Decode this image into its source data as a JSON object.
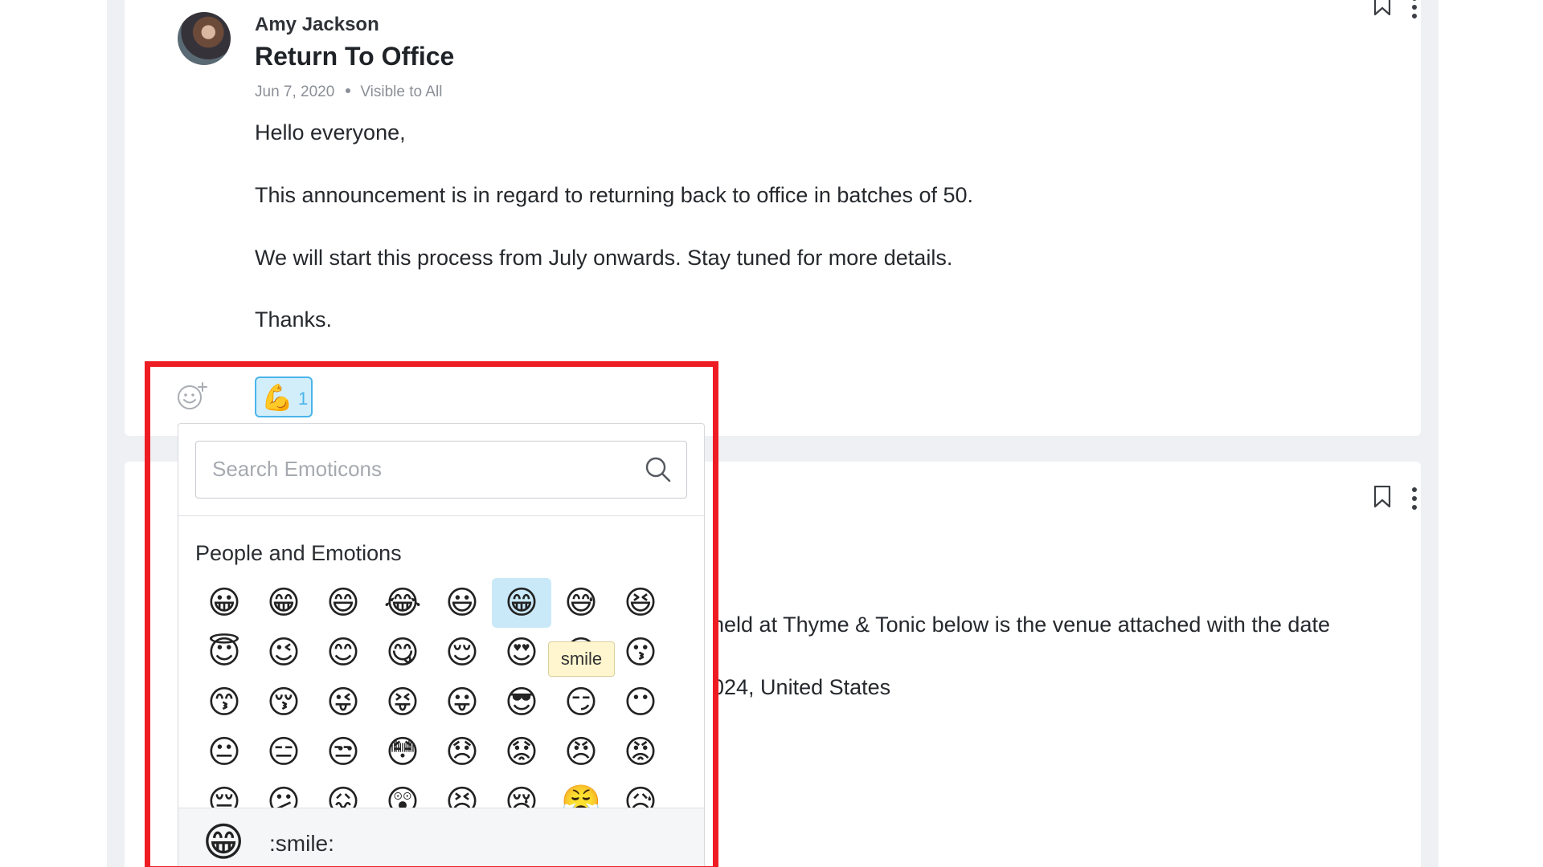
{
  "post1": {
    "author": "Amy Jackson",
    "title": "Return To Office",
    "date": "Jun 7, 2020",
    "visibility": "Visible to All",
    "body": [
      "Hello everyone,",
      "This announcement is in regard to returning back to office in batches of 50.",
      "We will start this process from July onwards. Stay tuned for more details.",
      "Thanks."
    ],
    "reaction": {
      "emoji": "💪",
      "count": "1"
    }
  },
  "post2": {
    "snippet_line1": "held at Thyme & Tonic below is the venue attached with the date",
    "snippet_line2": "024, United States"
  },
  "picker": {
    "search_placeholder": "Search Emoticons",
    "category": "People and Emotions",
    "emojis": [
      "😀",
      "😁",
      "😄",
      "😂",
      "😃",
      "😁",
      "😅",
      "😆",
      "😇",
      "😉",
      "😊",
      "😋",
      "😌",
      "😍",
      "😁",
      "😗",
      "😙",
      "😚",
      "😜",
      "😝",
      "😛",
      "😎",
      "😏",
      "😶",
      "😐",
      "😑",
      "😒",
      "😳",
      "😞",
      "😟",
      "😠",
      "😡",
      "😔",
      "😕",
      "😖",
      "😲",
      "😣",
      "😢",
      "😤",
      "😥"
    ],
    "selected_index": 5,
    "tooltip": "smile",
    "preview_emoji": "😁",
    "preview_code": ":smile:"
  }
}
